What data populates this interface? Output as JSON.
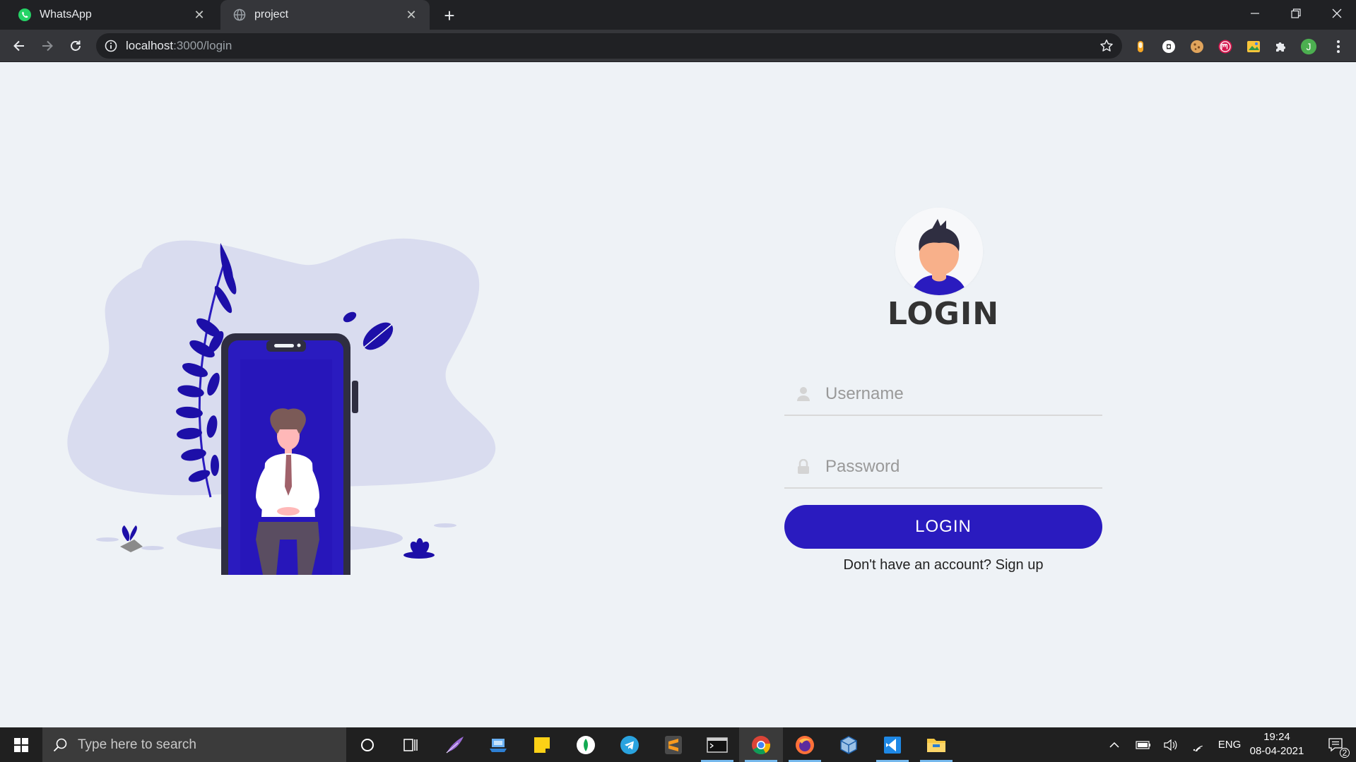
{
  "browser": {
    "tabs": [
      {
        "title": "WhatsApp",
        "favicon": "whatsapp-icon",
        "active": false
      },
      {
        "title": "project",
        "favicon": "globe-icon",
        "active": true
      }
    ],
    "address_bar": {
      "host": "localhost",
      "path": ":3000/login"
    },
    "extensions": [
      "honey-extension-icon",
      "adblock-extension-icon",
      "cookie-extension-icon",
      "mendeley-extension-icon",
      "google-keep-extension-icon",
      "puzzle-extensions-icon"
    ],
    "profile_initial": "J",
    "colors": {
      "tabbar": "#202124",
      "toolbar": "#35363a",
      "omnibox": "#202124"
    }
  },
  "login_page": {
    "title": "LOGIN",
    "username": {
      "placeholder": "Username",
      "value": ""
    },
    "password": {
      "placeholder": "Password",
      "value": ""
    },
    "submit_label": "LOGIN",
    "signup_prompt": "Don't have an account?",
    "signup_link": "Sign up",
    "colors": {
      "accent": "#2a1bbf",
      "background": "#eef2f6",
      "blob": "#d9dcef",
      "title": "#333333"
    }
  },
  "taskbar": {
    "search_placeholder": "Type here to search",
    "pinned_apps": [
      "cortana-icon",
      "task-view-icon",
      "quill-app-icon",
      "laptop-app-icon",
      "sticky-notes-icon",
      "mongodb-compass-icon",
      "telegram-icon",
      "sublime-text-icon",
      "terminal-icon",
      "chrome-icon",
      "firefox-icon",
      "virtualbox-icon",
      "vscode-icon",
      "file-explorer-icon"
    ],
    "tray": {
      "language": "ENG",
      "time": "19:24",
      "date": "08-04-2021",
      "notification_count": "2"
    }
  }
}
